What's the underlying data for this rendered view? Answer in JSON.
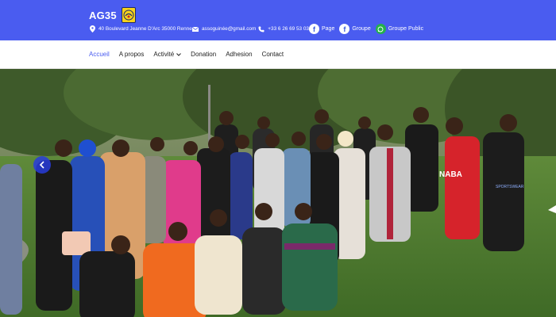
{
  "header": {
    "brand_name": "AG35",
    "address": "40 Boulevard Jeanne D'Arc 35000 Rennes",
    "email": "assoguinée@gmail.com",
    "phone": "+33 6 26 69 53 03",
    "social": [
      {
        "label": "Page",
        "icon": "facebook-icon"
      },
      {
        "label": "Groupe",
        "icon": "facebook-icon"
      },
      {
        "label": "Groupe Public",
        "icon": "whatsapp-icon"
      }
    ],
    "colors": {
      "bar": "#4a5cf0",
      "text": "#ffffff"
    }
  },
  "nav": {
    "items": [
      {
        "label": "Accueil",
        "active": true
      },
      {
        "label": "A propos"
      },
      {
        "label": "Activité",
        "has_dropdown": true
      },
      {
        "label": "Donation"
      },
      {
        "label": "Adhesion"
      },
      {
        "label": "Contact"
      }
    ],
    "active_color": "#4a5cf0"
  },
  "hero": {
    "description": "group photo",
    "shirt_text_1": "NABA",
    "shirt_text_2": "SPORTSWEAR"
  }
}
